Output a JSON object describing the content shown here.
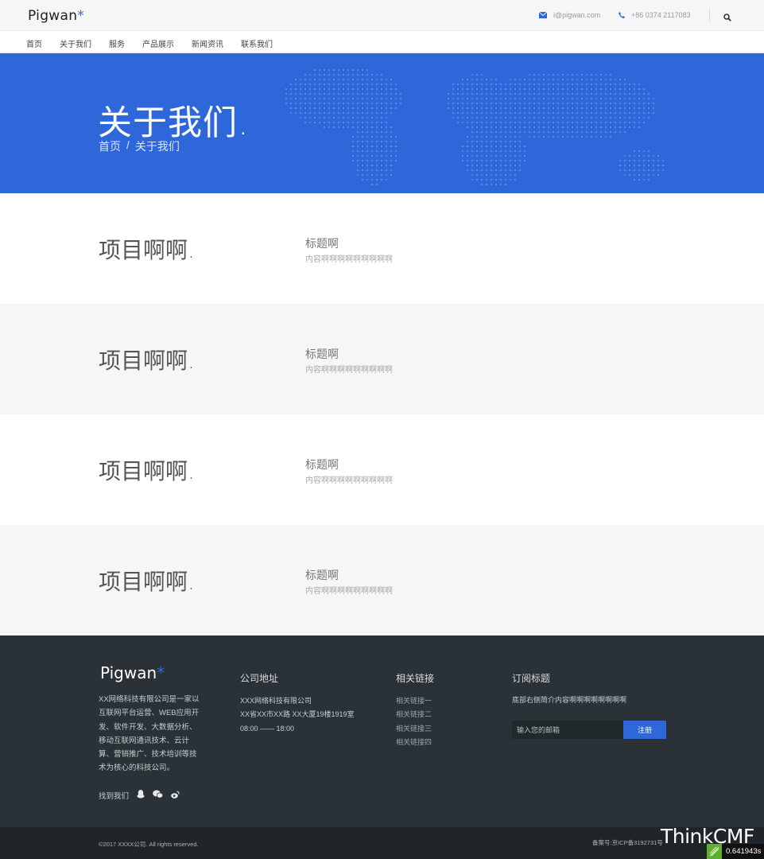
{
  "header": {
    "logo_text": "Pigwan",
    "logo_mark": "*",
    "email": "i@pigwan.com",
    "phone": "+86 0374 2117083",
    "icons": {
      "email": "envelope-icon",
      "phone": "phone-icon",
      "search": "search-icon"
    }
  },
  "nav": {
    "items": [
      {
        "label": "首页"
      },
      {
        "label": "关于我们"
      },
      {
        "label": "服务"
      },
      {
        "label": "产品展示"
      },
      {
        "label": "新闻资讯"
      },
      {
        "label": "联系我们"
      }
    ]
  },
  "hero": {
    "title": "关于我们.",
    "breadcrumb": {
      "home": "首页",
      "separator": "/",
      "current": "关于我们"
    },
    "background_color": "#2e67d9"
  },
  "projects": [
    {
      "heading": "项目啊啊.",
      "title": "标题啊",
      "text": "内容啊啊啊啊啊啊啊啊啊"
    },
    {
      "heading": "项目啊啊.",
      "title": "标题啊",
      "text": "内容啊啊啊啊啊啊啊啊啊"
    },
    {
      "heading": "项目啊啊.",
      "title": "标题啊",
      "text": "内容啊啊啊啊啊啊啊啊啊"
    },
    {
      "heading": "项目啊啊.",
      "title": "标题啊",
      "text": "内容啊啊啊啊啊啊啊啊啊"
    }
  ],
  "footer": {
    "logo_text": "Pigwan",
    "logo_mark": "*",
    "about": "XX网络科技有限公司是一家以互联网平台运营、WEB应用开发、软件开发、大数据分析、移动互联网通讯技术、云计算、营销推广、技术培训等技术为核心的科技公司。",
    "find_us": "找到我们",
    "social_icons": [
      "qq-icon",
      "wechat-icon",
      "weibo-icon"
    ],
    "address_title": "公司地址",
    "address_lines": [
      "XXX网络科技有限公司",
      "XX省XX市XX路 XX大厦19楼1919室",
      "08:00 —— 18:00"
    ],
    "links_title": "相关链接",
    "links": [
      "相关链接一",
      "相关链接二",
      "相关链接三",
      "相关链接四"
    ],
    "subscribe_title": "订阅标题",
    "subscribe_text": "底部右侧简介内容啊啊啊啊啊啊啊啊",
    "email_placeholder": "输入您的邮箱",
    "register_label": "注册",
    "background_color": "#2b3237",
    "accent_color": "#2e67d9"
  },
  "bottom": {
    "copyright": "©2017 XXXX公司. All rights reserved.",
    "icp": "备案号:京ICP备3192731号"
  },
  "debug": {
    "brand": "ThinkCMF",
    "time": "0.641943s"
  }
}
